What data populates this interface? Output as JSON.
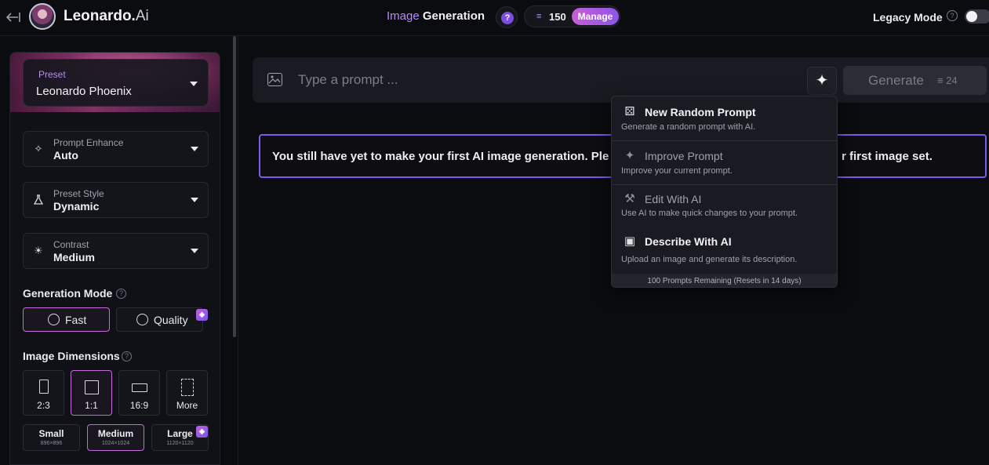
{
  "header": {
    "brand_name": "Leonardo.",
    "brand_suffix": "Ai",
    "title_highlight": "Image",
    "title_rest": " Generation",
    "credits": "150",
    "manage_label": "Manage",
    "legacy_mode_label": "Legacy Mode"
  },
  "sidebar": {
    "preset": {
      "label": "Preset",
      "value": "Leonardo Phoenix"
    },
    "prompt_enhance": {
      "label": "Prompt Enhance",
      "value": "Auto"
    },
    "preset_style": {
      "label": "Preset Style",
      "value": "Dynamic"
    },
    "contrast": {
      "label": "Contrast",
      "value": "Medium"
    },
    "generation_mode": {
      "title": "Generation Mode",
      "fast": "Fast",
      "quality": "Quality"
    },
    "image_dimensions": {
      "title": "Image Dimensions",
      "ratios": [
        "2:3",
        "1:1",
        "16:9",
        "More"
      ],
      "sizes": [
        {
          "label": "Small",
          "res": "896×896"
        },
        {
          "label": "Medium",
          "res": "1024×1024"
        },
        {
          "label": "Large",
          "res": "1120×1120"
        }
      ]
    }
  },
  "main": {
    "prompt_placeholder": "Type a prompt ...",
    "generate_label": "Generate",
    "generate_cost": "24",
    "banner_text": "You still have yet to make your first AI image generation. Ple"
  },
  "banner_tail": "r first image set.",
  "dropdown": {
    "items": [
      {
        "title": "New Random Prompt",
        "desc": "Generate a random prompt with AI."
      },
      {
        "title": "Improve Prompt",
        "desc": "Improve your current prompt."
      },
      {
        "title": "Edit With AI",
        "desc": "Use AI to make quick changes to your prompt."
      },
      {
        "title": "Describe With AI",
        "desc": "Upload an image and generate its description."
      }
    ],
    "footer": "100 Prompts Remaining (Resets in 14 days)"
  },
  "colors": {
    "accent_purple": "#b58cf6",
    "active_border": "#c56ad9",
    "banner_border": "#7c5ce8"
  }
}
